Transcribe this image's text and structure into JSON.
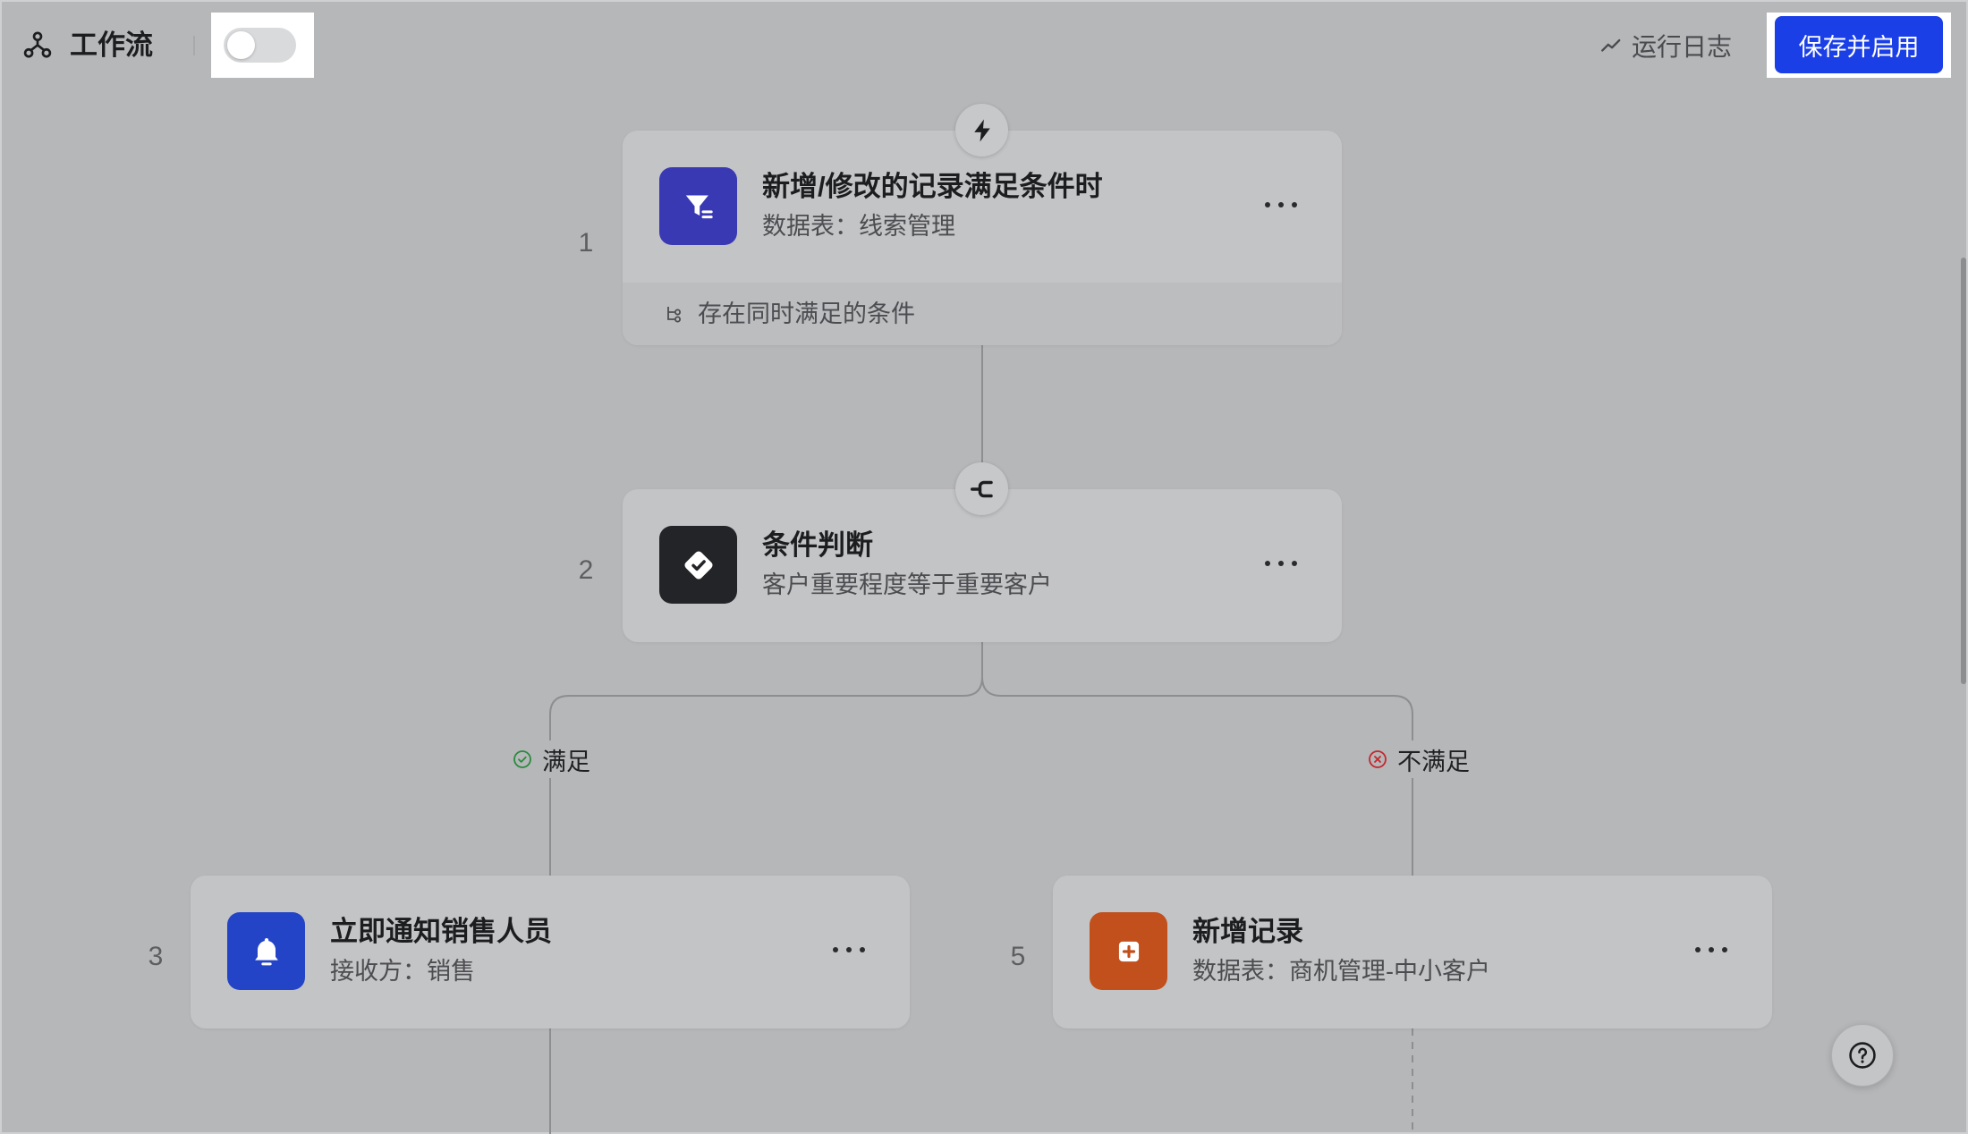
{
  "header": {
    "title": "工作流",
    "icon": "workflow-icon",
    "toggle_on": false,
    "run_log": {
      "label": "运行日志",
      "icon": "trend-icon"
    },
    "save_label": "保存并启用"
  },
  "colors": {
    "accent": "#1b3fe6",
    "success": "#2b8a3e",
    "danger": "#c4272d"
  },
  "nodes": [
    {
      "number": "1",
      "badge_icon": "lightning-icon",
      "icon": "filter-icon",
      "icon_color": "#3a39b4",
      "title": "新增/修改的记录满足条件时",
      "subtitle": "数据表：线索管理",
      "footer": {
        "icon": "condition-tree-icon",
        "label": "存在同时满足的条件"
      },
      "more_icon": "more-icon"
    },
    {
      "number": "2",
      "badge_icon": "branch-icon",
      "icon": "check-diamond-icon",
      "icon_color": "#232427",
      "title": "条件判断",
      "subtitle": "客户重要程度等于重要客户",
      "more_icon": "more-icon"
    },
    {
      "number": "3",
      "icon": "bell-icon",
      "icon_color": "#2444c7",
      "title": "立即通知销售人员",
      "subtitle": "接收方：销售",
      "more_icon": "more-icon"
    },
    {
      "number": "5",
      "icon": "plus-square-icon",
      "icon_color": "#c1501d",
      "title": "新增记录",
      "subtitle": "数据表：商机管理-中小客户",
      "more_icon": "more-icon"
    }
  ],
  "branches": {
    "yes": {
      "icon": "check-circle-icon",
      "label": "满足"
    },
    "no": {
      "icon": "x-circle-icon",
      "label": "不满足"
    }
  },
  "help": {
    "icon": "help-icon"
  }
}
